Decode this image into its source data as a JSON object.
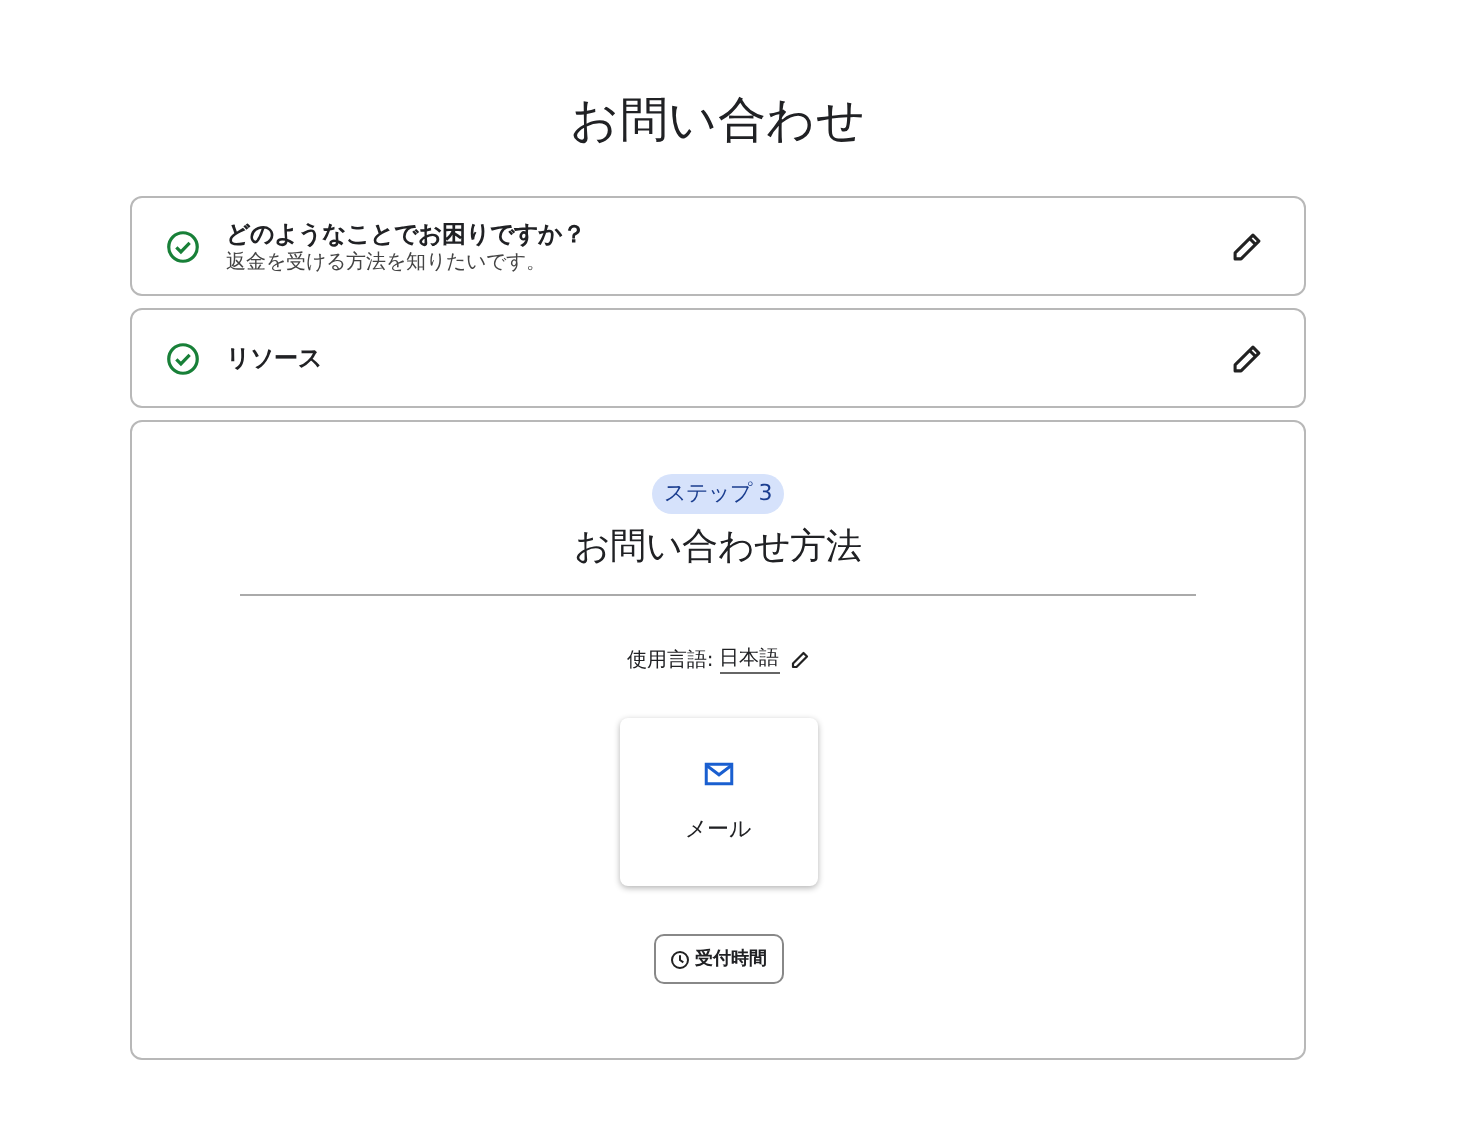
{
  "title": "お問い合わせ",
  "completed_steps": [
    {
      "title": "どのようなことでお困りですか？",
      "answer": "返金を受ける方法を知りたいです。",
      "completed": true
    },
    {
      "title": "リソース",
      "completed": true
    }
  ],
  "current_step": {
    "badge": "ステップ 3",
    "title": "お問い合わせ方法",
    "language_label": "使用言語:",
    "language": "日本語",
    "options": [
      {
        "label": "メール",
        "kind": "email"
      }
    ],
    "hours_button": "受付時間"
  }
}
